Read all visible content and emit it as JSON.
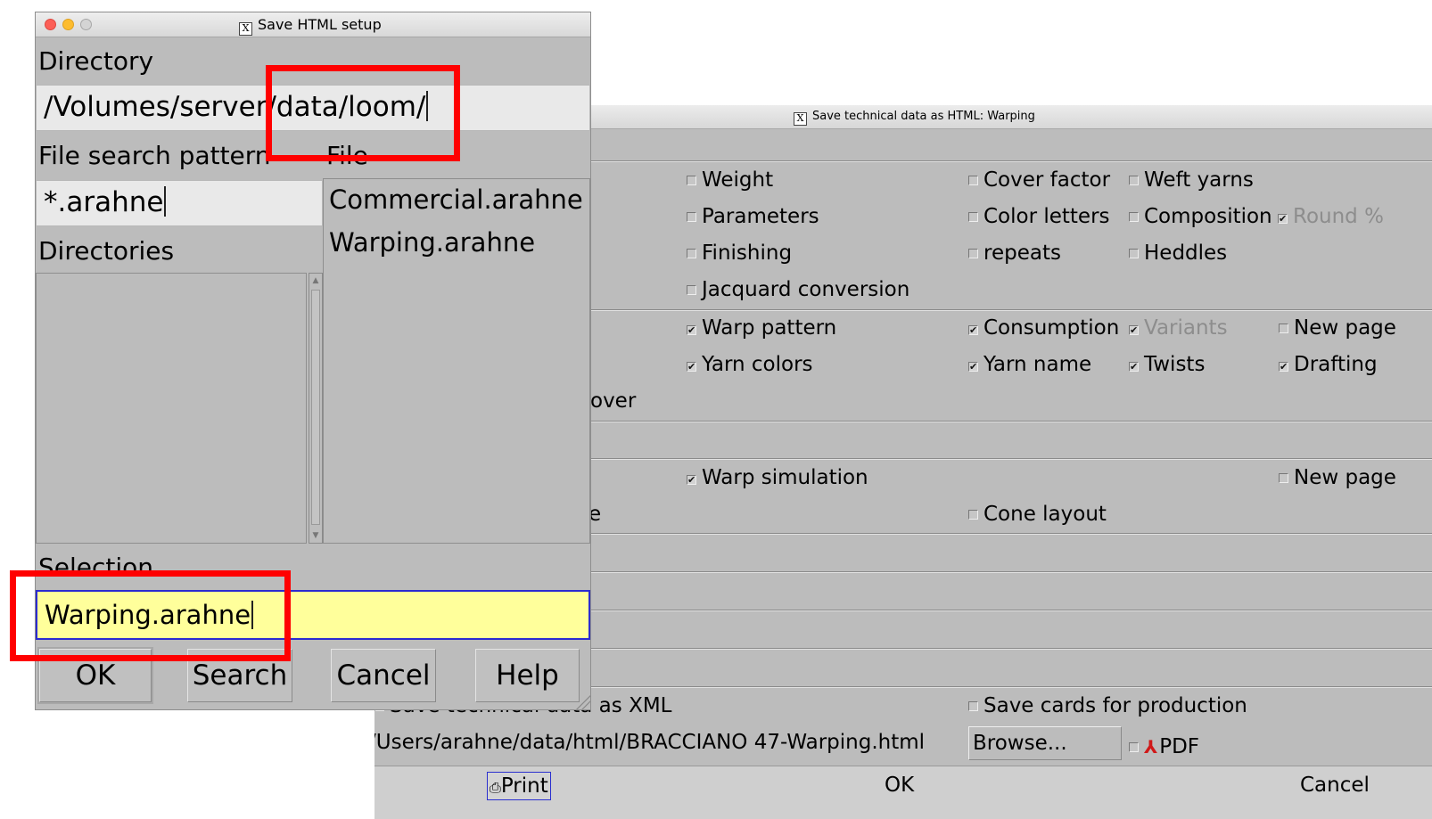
{
  "setup_dialog": {
    "title": "Save HTML setup",
    "directory_label": "Directory",
    "directory_value": "/Volumes/server/data/loom/",
    "pattern_label": "File search pattern",
    "file_label": "File",
    "pattern_value": "*.arahne",
    "directories_label": "Directories",
    "files": [
      "Commercial.arahne",
      "Warping.arahne"
    ],
    "selection_label": "Selection",
    "selection_value": "Warping.arahne",
    "buttons": {
      "ok": "OK",
      "search": "Search",
      "cancel": "Cancel",
      "help": "Help"
    }
  },
  "html_dialog": {
    "title": "Save technical data as HTML: Warping",
    "options": {
      "weight": {
        "label": "Weight",
        "checked": false
      },
      "cover_factor": {
        "label": "Cover factor",
        "checked": false
      },
      "weft_yarns": {
        "label": "Weft yarns",
        "checked": false
      },
      "parameters": {
        "label": "Parameters",
        "checked": false
      },
      "color_letters": {
        "label": "Color letters",
        "checked": false
      },
      "composition": {
        "label": "Composition",
        "checked": false
      },
      "round_pct": {
        "label": "Round %",
        "checked": true,
        "disabled": true
      },
      "finishing": {
        "label": "Finishing",
        "checked": false
      },
      "repeats": {
        "label": "repeats",
        "checked": false
      },
      "heddles": {
        "label": "Heddles",
        "checked": false
      },
      "jacquard_conversion": {
        "label": "Jacquard conversion",
        "checked": false
      },
      "warp_pattern": {
        "label": "Warp pattern",
        "checked": true
      },
      "consumption": {
        "label": "Consumption",
        "checked": true
      },
      "variants": {
        "label": "Variants",
        "checked": true,
        "disabled": true
      },
      "new_page_1": {
        "label": "New page",
        "checked": false
      },
      "yarn_colors": {
        "label": "Yarn colors",
        "checked": true
      },
      "yarn_name": {
        "label": "Yarn name",
        "checked": true
      },
      "twists": {
        "label": "Twists",
        "checked": true
      },
      "drafting": {
        "label": "Drafting",
        "checked": true
      },
      "warp_simulation": {
        "label": "Warp simulation",
        "checked": true
      },
      "new_page_2": {
        "label": "New page",
        "checked": false
      },
      "cone_layout": {
        "label": "Cone layout",
        "checked": false
      },
      "save_cards": {
        "label": "Save cards for production",
        "checked": false
      },
      "pdf": {
        "label": "PDF",
        "checked": false
      }
    },
    "fragments": {
      "over": "over",
      "e": "e",
      "save_xml": "Save technical data as XML"
    },
    "output_path": "/Users/arahne/data/html/BRACCIANO  47-Warping.html",
    "browse_label": "Browse...",
    "buttons": {
      "print": "Print",
      "ok": "OK",
      "cancel": "Cancel"
    }
  },
  "colors": {
    "highlight": "#ff0000",
    "selection_bg": "#ffff9b",
    "dialog_bg": "#bcbcbc"
  }
}
